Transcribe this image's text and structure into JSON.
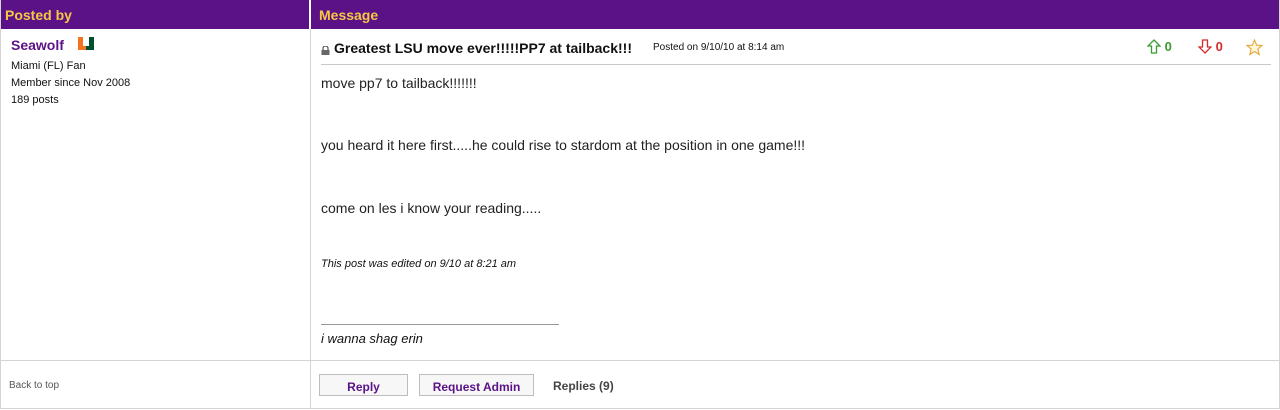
{
  "header": {
    "posted_by": "Posted by",
    "message": "Message"
  },
  "poster": {
    "username": "Seawolf",
    "team_logo": "miami-hurricanes-u-logo",
    "fan_of": "Miami (FL) Fan",
    "member_since": "Member since Nov 2008",
    "post_count": "189 posts"
  },
  "post": {
    "lock_icon": "lock-icon",
    "title": "Greatest LSU move ever!!!!!PP7 at tailback!!!",
    "posted_on": "Posted on 9/10/10 at 8:14 am",
    "upvotes": "0",
    "downvotes": "0",
    "upvote_color": "#3a9c2e",
    "downvote_color": "#d52b2b",
    "star_icon": "star-icon",
    "lines": [
      "move pp7 to tailback!!!!!!!",
      "you heard it here first.....he could rise to stardom at the position in one game!!!",
      "come on les i know your reading....."
    ],
    "edited_note": "This post was edited on 9/10 at 8:21 am",
    "signature": "i wanna shag erin"
  },
  "footer": {
    "back_to_top": "Back to top",
    "reply_label": "Reply",
    "request_admin_label": "Request Admin",
    "replies_label": "Replies (9)"
  },
  "colors": {
    "header_bg": "#5b1287",
    "header_text": "#f6c744"
  }
}
